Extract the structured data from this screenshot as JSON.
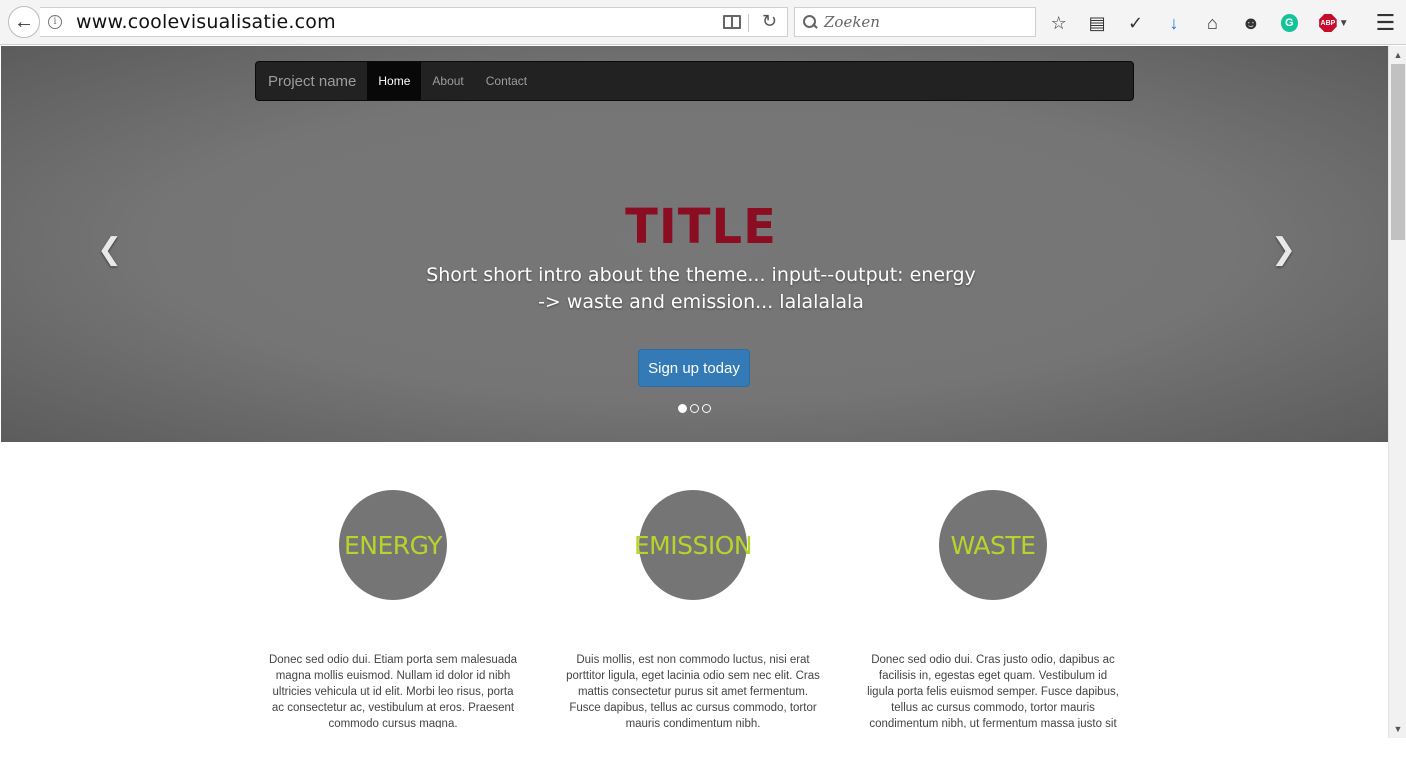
{
  "browser": {
    "url": "www.coolevisualisatie.com",
    "search_placeholder": "Zoeken",
    "toolbar_icons": [
      "bookmark-star-icon",
      "reading-list-icon",
      "pocket-icon",
      "download-icon",
      "home-icon",
      "emoji-icon",
      "grammarly-icon",
      "adblock-icon",
      "menu-icon"
    ],
    "adblock_label": "ABP",
    "grammarly_label": "G"
  },
  "navbar": {
    "brand": "Project name",
    "items": [
      {
        "label": "Home",
        "active": true
      },
      {
        "label": "About",
        "active": false
      },
      {
        "label": "Contact",
        "active": false
      }
    ]
  },
  "hero": {
    "title": "TITLE",
    "intro": "Short short intro about the theme... input--output: energy -> waste and emission... lalalalala",
    "button_label": "Sign up today",
    "title_color": "#8a0d22",
    "button_color": "#337ab7",
    "slide_count": 3,
    "active_slide": 0
  },
  "features": [
    {
      "label": "ENERGY",
      "text": "Donec sed odio dui. Etiam porta sem malesuada magna mollis euismod. Nullam id dolor id nibh ultricies vehicula ut id elit. Morbi leo risus, porta ac consectetur ac, vestibulum at eros. Praesent commodo cursus magna."
    },
    {
      "label": "EMISSION",
      "text": "Duis mollis, est non commodo luctus, nisi erat porttitor ligula, eget lacinia odio sem nec elit. Cras mattis consectetur purus sit amet fermentum. Fusce dapibus, tellus ac cursus commodo, tortor mauris condimentum nibh."
    },
    {
      "label": "WASTE",
      "text": "Donec sed odio dui. Cras justo odio, dapibus ac facilisis in, egestas eget quam. Vestibulum id ligula porta felis euismod semper. Fusce dapibus, tellus ac cursus commodo, tortor mauris condimentum nibh, ut fermentum massa justo sit amet risus."
    }
  ],
  "colors": {
    "feature_label": "#b6d52a",
    "circle": "#757575"
  }
}
